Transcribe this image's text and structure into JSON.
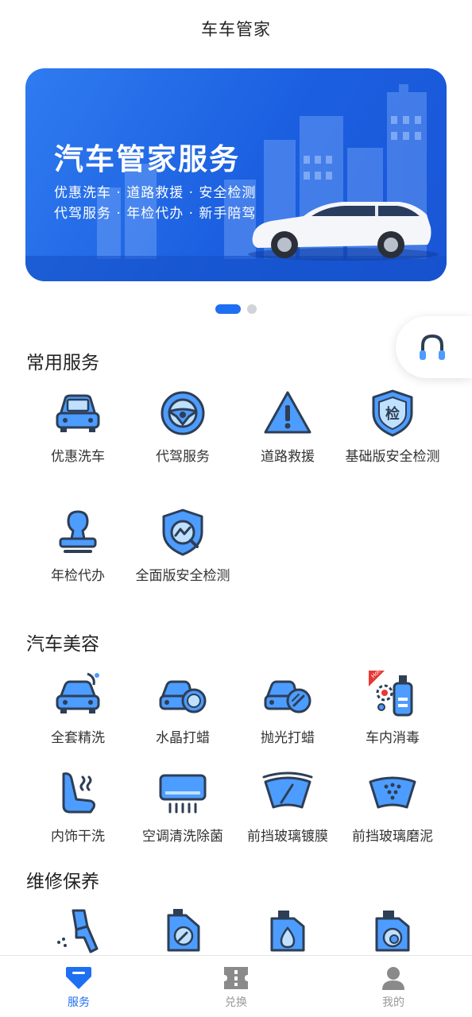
{
  "header": {
    "title": "车车管家"
  },
  "banner": {
    "title": "汽车管家服务",
    "line1": "优惠洗车 · 道路救援 · 安全检测",
    "line2": "代驾服务 · 年检代办 · 新手陪驾"
  },
  "carousel": {
    "active_index": 0,
    "count": 2
  },
  "sections": {
    "common": {
      "title": "常用服务",
      "items": [
        {
          "label": "优惠洗车",
          "icon": "car-wash-icon"
        },
        {
          "label": "代驾服务",
          "icon": "steering-wheel-icon"
        },
        {
          "label": "道路救援",
          "icon": "warning-triangle-icon"
        },
        {
          "label": "基础版安全检测",
          "icon": "shield-check-icon"
        },
        {
          "label": "年检代办",
          "icon": "stamp-icon"
        },
        {
          "label": "全面版安全检测",
          "icon": "shield-chart-icon"
        }
      ]
    },
    "beauty": {
      "title": "汽车美容",
      "items": [
        {
          "label": "全套精洗",
          "icon": "car-spray-icon"
        },
        {
          "label": "水晶打蜡",
          "icon": "car-wax-icon"
        },
        {
          "label": "抛光打蜡",
          "icon": "car-polish-icon"
        },
        {
          "label": "车内消毒",
          "icon": "disinfect-icon",
          "badge": "Hot"
        },
        {
          "label": "内饰干洗",
          "icon": "car-seat-icon"
        },
        {
          "label": "空调清洗除菌",
          "icon": "air-conditioner-icon"
        },
        {
          "label": "前挡玻璃镀膜",
          "icon": "windshield-coating-icon"
        },
        {
          "label": "前挡玻璃磨泥",
          "icon": "windshield-clay-icon"
        }
      ]
    },
    "repair": {
      "title": "维修保养",
      "items": [
        {
          "label": "",
          "icon": "spray-gun-icon"
        },
        {
          "label": "",
          "icon": "oil-wrench-icon"
        },
        {
          "label": "",
          "icon": "oil-drop-icon"
        },
        {
          "label": "",
          "icon": "oil-filter-icon"
        }
      ]
    }
  },
  "tabbar": {
    "items": [
      {
        "label": "服务",
        "icon": "service-icon",
        "active": true
      },
      {
        "label": "兑换",
        "icon": "ticket-icon",
        "active": false
      },
      {
        "label": "我的",
        "icon": "user-icon",
        "active": false
      }
    ]
  },
  "colors": {
    "primary": "#1f6ff2",
    "icon_fill": "#4d9cff",
    "icon_stroke": "#2d3e55"
  }
}
